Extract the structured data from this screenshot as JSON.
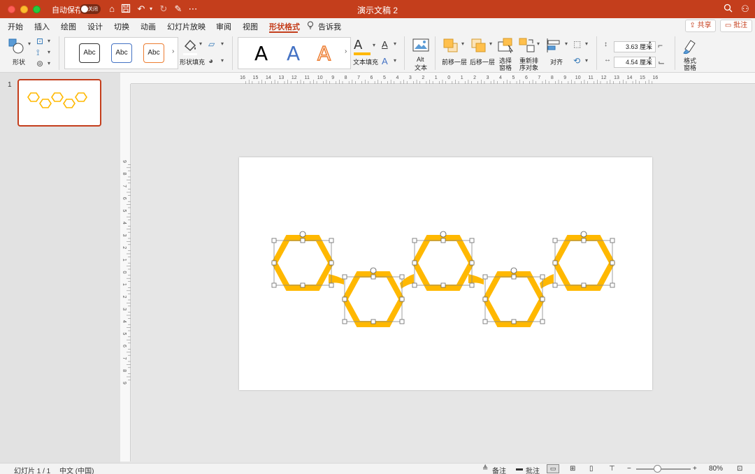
{
  "titlebar": {
    "autosave_label": "自动保存",
    "autosave_state": "关闭",
    "doc_title": "演示文稿 2"
  },
  "menu": {
    "items": [
      "开始",
      "插入",
      "绘图",
      "设计",
      "切换",
      "动画",
      "幻灯片放映",
      "审阅",
      "视图",
      "形状格式",
      "告诉我"
    ],
    "active": "形状格式",
    "share_label": "共享",
    "comments_label": "批注"
  },
  "ribbon": {
    "shape_label": "形状",
    "shape_styles": [
      "Abc",
      "Abc",
      "Abc"
    ],
    "shape_fill_label": "形状填充",
    "wordart_letters": [
      "A",
      "A",
      "A"
    ],
    "text_fill_label": "文本填充",
    "alt_text_label": [
      "Alt",
      "文本"
    ],
    "bring_forward_label": "前移一层",
    "send_backward_label": "后移一层",
    "selection_pane_label": [
      "选择",
      "窗格"
    ],
    "reorder_label": [
      "重新排",
      "序对象"
    ],
    "align_label": "对齐",
    "height_value": "3.63 厘米",
    "width_value": "4.54 厘米",
    "format_pane_label": [
      "格式",
      "窗格"
    ],
    "colors": {
      "accent": "#c43e1c",
      "shape_fill": "#ffb800",
      "style1": "#333333",
      "style2": "#4472c4",
      "style3": "#ed7d31"
    }
  },
  "slides_panel": {
    "slide_number": "1"
  },
  "rulers": {
    "horizontal_labels": [
      "16",
      "15",
      "14",
      "13",
      "12",
      "11",
      "10",
      "9",
      "8",
      "7",
      "6",
      "5",
      "4",
      "3",
      "2",
      "1",
      "0",
      "1",
      "2",
      "3",
      "4",
      "5",
      "6",
      "7",
      "8",
      "9",
      "10",
      "11",
      "12",
      "13",
      "14",
      "15",
      "16"
    ],
    "vertical_labels": [
      "9",
      "8",
      "7",
      "6",
      "5",
      "4",
      "3",
      "2",
      "1",
      "0",
      "1",
      "2",
      "3",
      "4",
      "5",
      "6",
      "7",
      "8",
      "9"
    ]
  },
  "statusbar": {
    "slide_info": "幻灯片 1 / 1",
    "language": "中文 (中国)",
    "notes_label": "备注",
    "comments_label": "批注",
    "zoom": "80%"
  }
}
